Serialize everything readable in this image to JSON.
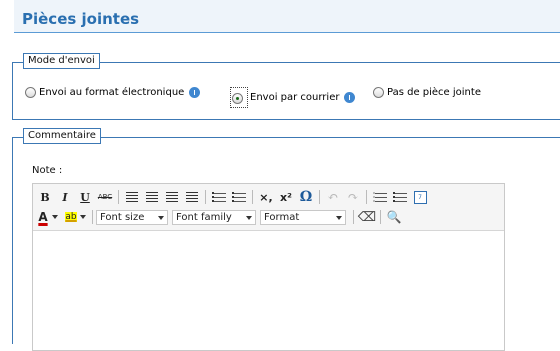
{
  "section_title": "Pièces jointes",
  "mode": {
    "legend": "Mode d'envoi",
    "options": [
      {
        "label": "Envoi au format électronique",
        "checked": false,
        "info": true
      },
      {
        "label": "Envoi par courrier",
        "checked": true,
        "info": true
      },
      {
        "label": "Pas de pièce jointe",
        "checked": false,
        "info": false
      }
    ]
  },
  "comment": {
    "legend": "Commentaire",
    "note_label": "Note :",
    "toolbar": {
      "bold": "B",
      "italic": "I",
      "underline": "U",
      "strike": "ABC",
      "subscript": "×,",
      "superscript": "x²",
      "omega": "Ω",
      "font_size": "Font size",
      "font_family": "Font family",
      "format": "Format"
    }
  }
}
